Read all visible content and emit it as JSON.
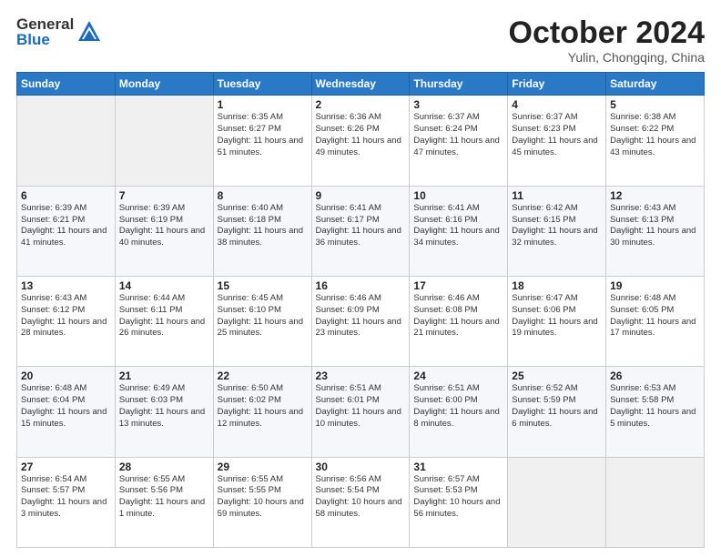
{
  "logo": {
    "general": "General",
    "blue": "Blue"
  },
  "title": "October 2024",
  "subtitle": "Yulin, Chongqing, China",
  "days_of_week": [
    "Sunday",
    "Monday",
    "Tuesday",
    "Wednesday",
    "Thursday",
    "Friday",
    "Saturday"
  ],
  "weeks": [
    [
      {
        "day": "",
        "info": ""
      },
      {
        "day": "",
        "info": ""
      },
      {
        "day": "1",
        "info": "Sunrise: 6:35 AM\nSunset: 6:27 PM\nDaylight: 11 hours and 51 minutes."
      },
      {
        "day": "2",
        "info": "Sunrise: 6:36 AM\nSunset: 6:26 PM\nDaylight: 11 hours and 49 minutes."
      },
      {
        "day": "3",
        "info": "Sunrise: 6:37 AM\nSunset: 6:24 PM\nDaylight: 11 hours and 47 minutes."
      },
      {
        "day": "4",
        "info": "Sunrise: 6:37 AM\nSunset: 6:23 PM\nDaylight: 11 hours and 45 minutes."
      },
      {
        "day": "5",
        "info": "Sunrise: 6:38 AM\nSunset: 6:22 PM\nDaylight: 11 hours and 43 minutes."
      }
    ],
    [
      {
        "day": "6",
        "info": "Sunrise: 6:39 AM\nSunset: 6:21 PM\nDaylight: 11 hours and 41 minutes."
      },
      {
        "day": "7",
        "info": "Sunrise: 6:39 AM\nSunset: 6:19 PM\nDaylight: 11 hours and 40 minutes."
      },
      {
        "day": "8",
        "info": "Sunrise: 6:40 AM\nSunset: 6:18 PM\nDaylight: 11 hours and 38 minutes."
      },
      {
        "day": "9",
        "info": "Sunrise: 6:41 AM\nSunset: 6:17 PM\nDaylight: 11 hours and 36 minutes."
      },
      {
        "day": "10",
        "info": "Sunrise: 6:41 AM\nSunset: 6:16 PM\nDaylight: 11 hours and 34 minutes."
      },
      {
        "day": "11",
        "info": "Sunrise: 6:42 AM\nSunset: 6:15 PM\nDaylight: 11 hours and 32 minutes."
      },
      {
        "day": "12",
        "info": "Sunrise: 6:43 AM\nSunset: 6:13 PM\nDaylight: 11 hours and 30 minutes."
      }
    ],
    [
      {
        "day": "13",
        "info": "Sunrise: 6:43 AM\nSunset: 6:12 PM\nDaylight: 11 hours and 28 minutes."
      },
      {
        "day": "14",
        "info": "Sunrise: 6:44 AM\nSunset: 6:11 PM\nDaylight: 11 hours and 26 minutes."
      },
      {
        "day": "15",
        "info": "Sunrise: 6:45 AM\nSunset: 6:10 PM\nDaylight: 11 hours and 25 minutes."
      },
      {
        "day": "16",
        "info": "Sunrise: 6:46 AM\nSunset: 6:09 PM\nDaylight: 11 hours and 23 minutes."
      },
      {
        "day": "17",
        "info": "Sunrise: 6:46 AM\nSunset: 6:08 PM\nDaylight: 11 hours and 21 minutes."
      },
      {
        "day": "18",
        "info": "Sunrise: 6:47 AM\nSunset: 6:06 PM\nDaylight: 11 hours and 19 minutes."
      },
      {
        "day": "19",
        "info": "Sunrise: 6:48 AM\nSunset: 6:05 PM\nDaylight: 11 hours and 17 minutes."
      }
    ],
    [
      {
        "day": "20",
        "info": "Sunrise: 6:48 AM\nSunset: 6:04 PM\nDaylight: 11 hours and 15 minutes."
      },
      {
        "day": "21",
        "info": "Sunrise: 6:49 AM\nSunset: 6:03 PM\nDaylight: 11 hours and 13 minutes."
      },
      {
        "day": "22",
        "info": "Sunrise: 6:50 AM\nSunset: 6:02 PM\nDaylight: 11 hours and 12 minutes."
      },
      {
        "day": "23",
        "info": "Sunrise: 6:51 AM\nSunset: 6:01 PM\nDaylight: 11 hours and 10 minutes."
      },
      {
        "day": "24",
        "info": "Sunrise: 6:51 AM\nSunset: 6:00 PM\nDaylight: 11 hours and 8 minutes."
      },
      {
        "day": "25",
        "info": "Sunrise: 6:52 AM\nSunset: 5:59 PM\nDaylight: 11 hours and 6 minutes."
      },
      {
        "day": "26",
        "info": "Sunrise: 6:53 AM\nSunset: 5:58 PM\nDaylight: 11 hours and 5 minutes."
      }
    ],
    [
      {
        "day": "27",
        "info": "Sunrise: 6:54 AM\nSunset: 5:57 PM\nDaylight: 11 hours and 3 minutes."
      },
      {
        "day": "28",
        "info": "Sunrise: 6:55 AM\nSunset: 5:56 PM\nDaylight: 11 hours and 1 minute."
      },
      {
        "day": "29",
        "info": "Sunrise: 6:55 AM\nSunset: 5:55 PM\nDaylight: 10 hours and 59 minutes."
      },
      {
        "day": "30",
        "info": "Sunrise: 6:56 AM\nSunset: 5:54 PM\nDaylight: 10 hours and 58 minutes."
      },
      {
        "day": "31",
        "info": "Sunrise: 6:57 AM\nSunset: 5:53 PM\nDaylight: 10 hours and 56 minutes."
      },
      {
        "day": "",
        "info": ""
      },
      {
        "day": "",
        "info": ""
      }
    ]
  ]
}
